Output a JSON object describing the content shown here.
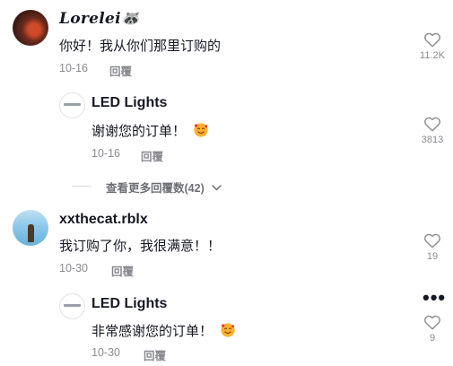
{
  "comments": [
    {
      "username": "Lorelei🦝",
      "text": "你好！我从你们那里订购的",
      "date": "10-16",
      "reply_label": "回覆",
      "likes": "11.2K",
      "replies": [
        {
          "username": "LED Lights",
          "text": "谢谢您的订单！",
          "date": "10-16",
          "reply_label": "回覆",
          "likes": "3813"
        }
      ],
      "view_more": "查看更多回覆数(42)"
    },
    {
      "username": "xxthecat.rblx",
      "text": "我订购了你，我很满意！！",
      "date": "10-30",
      "reply_label": "回覆",
      "likes": "19",
      "replies": [
        {
          "username": "LED Lights",
          "text": "非常感谢您的订单！",
          "date": "10-30",
          "reply_label": "回覆",
          "likes": "9"
        }
      ]
    }
  ],
  "icons": {
    "like": "heart-outline-icon",
    "more": "more-dots-icon",
    "expand": "chevron-down-icon",
    "emoji": "smiling-face-with-hearts-emoji"
  },
  "colors": {
    "text": "#161823",
    "muted": "#8a8b91",
    "emoji": "#ffb02e"
  }
}
